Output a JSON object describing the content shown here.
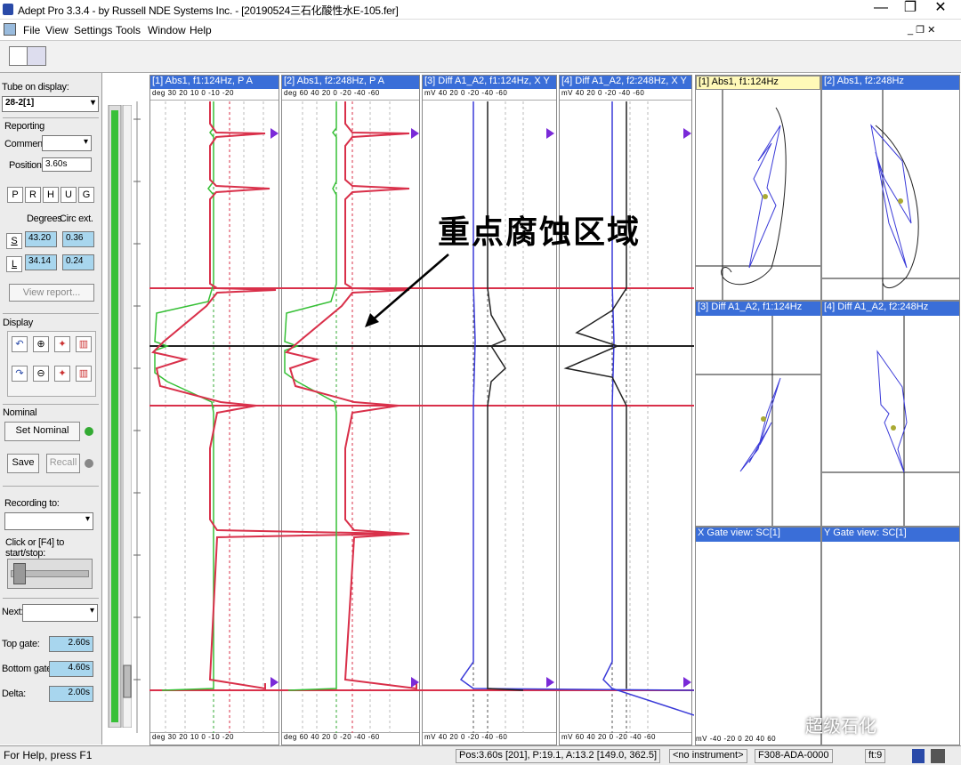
{
  "window": {
    "title": "Adept Pro 3.3.4 - by Russell NDE Systems Inc. - [20190524三石化酸性水E-105.fer]",
    "minimize": "—",
    "maximize": "❐",
    "close": "✕"
  },
  "menu": [
    "File",
    "View",
    "Settings",
    "Tools",
    "Window",
    "Help"
  ],
  "menu_right": "_ ❐ ✕",
  "left": {
    "tube_label": "Tube on display:",
    "tube_value": "28-2[1]",
    "reporting_label": "Reporting",
    "comment_label": "Comment:",
    "position_label": "Position:",
    "position_value": "3.60s",
    "phrug": [
      "P",
      "R",
      "H",
      "U",
      "G"
    ],
    "degrees_label": "Degrees",
    "circ_label": "Circ ext.",
    "s_label": "S",
    "s_deg": "43.20",
    "s_circ": "0.36",
    "l_label": "L",
    "l_deg": "34.14",
    "l_circ": "0.24",
    "view_report": "View report...",
    "display_label": "Display",
    "nominal_label": "Nominal",
    "set_nominal": "Set Nominal",
    "save": "Save",
    "recall": "Recall",
    "recording_label": "Recording to:",
    "click_label": "Click or [F4] to start/stop:",
    "next_label": "Next:",
    "top_gate_label": "Top gate:",
    "top_gate": "2.60s",
    "bottom_gate_label": "Bottom gate:",
    "bottom_gate": "4.60s",
    "delta_label": "Delta:",
    "delta": "2.00s"
  },
  "strips": [
    {
      "title": "[1] Abs1, f1:124Hz, P A",
      "scale": "deg 30  20  10   0  -10  -20",
      "bscale": "deg 30  20  10   0  -10  -20"
    },
    {
      "title": "[2] Abs1, f2:248Hz, P A",
      "scale": "deg 60  40  20   0  -20 -40 -60",
      "bscale": "deg 60  40  20   0  -20 -40 -60"
    },
    {
      "title": "[3] Diff A1_A2, f1:124Hz, X Y",
      "scale": "mV  40  20   0  -20  -40  -60",
      "bscale": "mV  40  20   0  -20  -40  -60"
    },
    {
      "title": "[4] Diff A1_A2, f2:248Hz, X Y",
      "scale": "mV  40  20   0  -20  -40  -60",
      "bscale": "mV 60  40  20   0  -20  -40  -60"
    }
  ],
  "lissajous": [
    {
      "title": "[1] Abs1, f1:124Hz"
    },
    {
      "title": "[2] Abs1, f2:248Hz"
    },
    {
      "title": "[3] Diff A1_A2, f1:124Hz"
    },
    {
      "title": "[4] Diff A1_A2, f2:248Hz"
    },
    {
      "title": "X Gate view: SC[1]"
    },
    {
      "title": "Y Gate view: SC[1]"
    }
  ],
  "gate_scale": "mV  -40  -20   0   20   40   60",
  "annotation": "重点腐蚀区域",
  "status": {
    "help": "For Help, press F1",
    "pos": "Pos:3.60s [201], P:19.1, A:13.2 [149.0, 362.5]",
    "instrument": "<no instrument>",
    "code": "F308-ADA-0000",
    "ft": "ft:9"
  },
  "watermark": "超级石化",
  "colors": {
    "header_blue": "#3a6ed8",
    "red_trace": "#d9304a",
    "green_trace": "#36c036",
    "blue_trace": "#3a3ad8",
    "dark_trace": "#222222",
    "marker": "#7a2ad8"
  }
}
